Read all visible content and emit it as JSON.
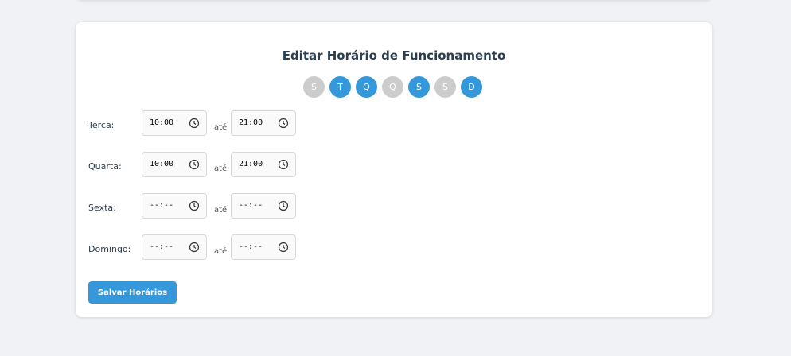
{
  "title": "Editar Horário de Funcionamento",
  "days": [
    {
      "label": "S",
      "active": false
    },
    {
      "label": "T",
      "active": true
    },
    {
      "label": "Q",
      "active": true
    },
    {
      "label": "Q",
      "active": false
    },
    {
      "label": "S",
      "active": true
    },
    {
      "label": "S",
      "active": false
    },
    {
      "label": "D",
      "active": true
    }
  ],
  "schedule": [
    {
      "day": "Terca:",
      "start": "10:00",
      "separator": "até",
      "end": "21:00"
    },
    {
      "day": "Quarta:",
      "start": "10:00",
      "separator": "até",
      "end": "21:00"
    },
    {
      "day": "Sexta:",
      "start": "--:--",
      "separator": "até",
      "end": "--:--"
    },
    {
      "day": "Domingo:",
      "start": "--:--",
      "separator": "até",
      "end": "--:--"
    }
  ],
  "save_label": "Salvar Horários",
  "colors": {
    "accent": "#3498db",
    "inactive_day": "#cccccc",
    "background": "#f0f2f5"
  }
}
